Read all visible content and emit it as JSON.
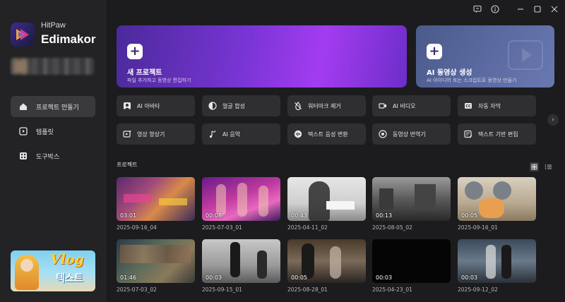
{
  "app": {
    "brand_top": "HitPaw",
    "brand_name": "Edimakor"
  },
  "sidebar": {
    "items": [
      {
        "label": "프로젝트 만들기",
        "icon": "home-icon",
        "active": true
      },
      {
        "label": "템플릿",
        "icon": "template-icon",
        "active": false
      },
      {
        "label": "도구박스",
        "icon": "toolbox-icon",
        "active": false
      }
    ],
    "promo": {
      "title": "Vlog",
      "subtitle": "텍스트"
    }
  },
  "hero": {
    "new_project": {
      "title": "새 프로젝트",
      "subtitle": "파일 추가하고 동영상 편집하기"
    },
    "ai_video": {
      "title": "AI 동영상 생성",
      "subtitle": "AI 아이디어 또는 스크립트로 동영상 만들기"
    }
  },
  "tools": [
    {
      "label": "AI 아바타",
      "icon": "avatar-icon"
    },
    {
      "label": "얼굴 합성",
      "icon": "face-swap-icon"
    },
    {
      "label": "워터마크 제거",
      "icon": "watermark-remove-icon"
    },
    {
      "label": "AI 비디오",
      "icon": "ai-video-icon"
    },
    {
      "label": "자동 자막",
      "icon": "caption-icon"
    },
    {
      "label": "영상 향상기",
      "icon": "enhance-icon"
    },
    {
      "label": "AI 음악",
      "icon": "music-icon"
    },
    {
      "label": "텍스트 음성 변환",
      "icon": "tts-icon"
    },
    {
      "label": "동영상 번역기",
      "icon": "translate-icon"
    },
    {
      "label": "텍스트 기반 편집",
      "icon": "text-edit-icon"
    }
  ],
  "projects_title": "프로젝트",
  "projects": [
    {
      "name": "2025-09-16_04",
      "duration": "03:01"
    },
    {
      "name": "2025-07-03_01",
      "duration": "00:08"
    },
    {
      "name": "2025-04-11_02",
      "duration": "00:43"
    },
    {
      "name": "2025-08-05_02",
      "duration": "00:13"
    },
    {
      "name": "2025-09-16_01",
      "duration": "00:05"
    },
    {
      "name": "2025-07-03_02",
      "duration": "01:46"
    },
    {
      "name": "2025-09-15_01",
      "duration": "00:03"
    },
    {
      "name": "2025-08-28_01",
      "duration": "00:05"
    },
    {
      "name": "2025-04-23_01",
      "duration": "00:03"
    },
    {
      "name": "2025-09-12_02",
      "duration": "00:03"
    }
  ],
  "colors": {
    "background": "#1c1c1e",
    "sidebar": "#232325",
    "button": "#2f2f32",
    "accent": "#7a35d6"
  }
}
